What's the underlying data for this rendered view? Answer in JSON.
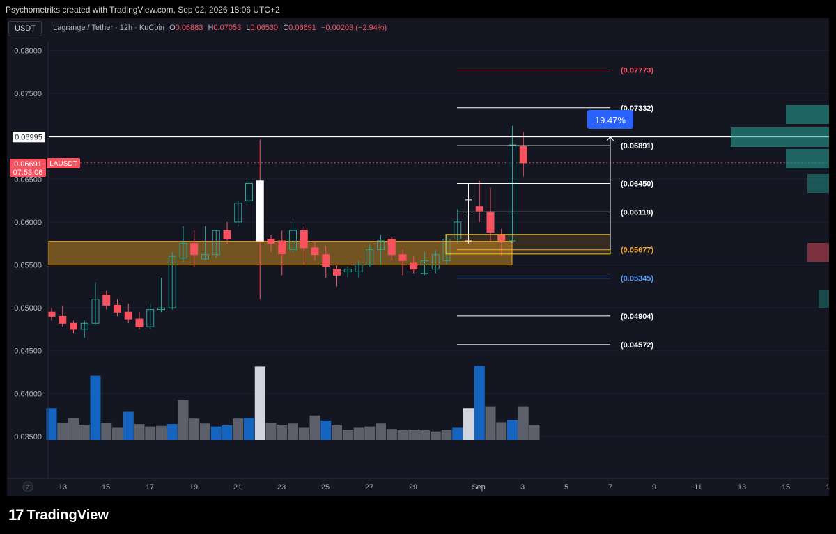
{
  "watermark": "Psychometriks created with TradingView.com, Sep 02, 2026 18:06 UTC+2",
  "symbol_box": "USDT",
  "header": {
    "title": "Lagrange / Tether · 12h · KuCoin",
    "o_label": "O",
    "o": "0.06883",
    "h_label": "H",
    "h": "0.07053",
    "l_label": "L",
    "l": "0.06530",
    "c_label": "C",
    "c": "0.06691",
    "change": "−0.00203 (−2.94%)"
  },
  "price_axis": {
    "ticks": [
      "0.08000",
      "0.07500",
      "0.06500",
      "0.06000",
      "0.05500",
      "0.05000",
      "0.04500",
      "0.04000",
      "0.03500"
    ],
    "horizontal_line_label": "0.06995",
    "last_price_label": "0.06691",
    "countdown": "07:53:06",
    "ticker_tag": "LAUSDT"
  },
  "time_axis": {
    "ticks": [
      "13",
      "15",
      "17",
      "19",
      "21",
      "23",
      "25",
      "27",
      "29",
      "Sep",
      "3",
      "5",
      "7",
      "9",
      "11",
      "13",
      "15",
      "1"
    ],
    "z_button": "Z"
  },
  "measure_label": "19.47%",
  "brand": "TradingView",
  "colors": {
    "up": "#26a69a",
    "down": "#f7525f",
    "zone": "#f5a623",
    "background": "#141722"
  },
  "chart_data": {
    "type": "candlestick",
    "timeframe": "12h",
    "ylim": [
      0.033,
      0.0825
    ],
    "candles": [
      {
        "o": 0.0495,
        "h": 0.05,
        "l": 0.0485,
        "c": 0.049
      },
      {
        "o": 0.049,
        "h": 0.0502,
        "l": 0.0478,
        "c": 0.0482
      },
      {
        "o": 0.0482,
        "h": 0.0485,
        "l": 0.047,
        "c": 0.0475
      },
      {
        "o": 0.0475,
        "h": 0.0485,
        "l": 0.0465,
        "c": 0.0482
      },
      {
        "o": 0.0482,
        "h": 0.053,
        "l": 0.048,
        "c": 0.051
      },
      {
        "o": 0.0515,
        "h": 0.052,
        "l": 0.0498,
        "c": 0.0503
      },
      {
        "o": 0.0503,
        "h": 0.051,
        "l": 0.049,
        "c": 0.0495
      },
      {
        "o": 0.0495,
        "h": 0.0505,
        "l": 0.0482,
        "c": 0.0487
      },
      {
        "o": 0.0487,
        "h": 0.0495,
        "l": 0.0475,
        "c": 0.0478
      },
      {
        "o": 0.0478,
        "h": 0.0505,
        "l": 0.0475,
        "c": 0.0498
      },
      {
        "o": 0.0498,
        "h": 0.0535,
        "l": 0.0495,
        "c": 0.05
      },
      {
        "o": 0.05,
        "h": 0.0565,
        "l": 0.0498,
        "c": 0.056
      },
      {
        "o": 0.0558,
        "h": 0.0595,
        "l": 0.0553,
        "c": 0.0575
      },
      {
        "o": 0.0575,
        "h": 0.059,
        "l": 0.0548,
        "c": 0.0562
      },
      {
        "o": 0.0557,
        "h": 0.0595,
        "l": 0.0555,
        "c": 0.0562
      },
      {
        "o": 0.0562,
        "h": 0.059,
        "l": 0.0558,
        "c": 0.059
      },
      {
        "o": 0.059,
        "h": 0.06,
        "l": 0.0575,
        "c": 0.058
      },
      {
        "o": 0.06,
        "h": 0.0625,
        "l": 0.0595,
        "c": 0.0622
      },
      {
        "o": 0.0625,
        "h": 0.065,
        "l": 0.062,
        "c": 0.0645
      },
      {
        "o": 0.0578,
        "h": 0.0696,
        "l": 0.051,
        "c": 0.0648
      },
      {
        "o": 0.058,
        "h": 0.0585,
        "l": 0.0565,
        "c": 0.0575
      },
      {
        "o": 0.0578,
        "h": 0.059,
        "l": 0.0538,
        "c": 0.0563
      },
      {
        "o": 0.0568,
        "h": 0.06,
        "l": 0.0565,
        "c": 0.059
      },
      {
        "o": 0.059,
        "h": 0.0595,
        "l": 0.055,
        "c": 0.057
      },
      {
        "o": 0.057,
        "h": 0.0578,
        "l": 0.0555,
        "c": 0.0562
      },
      {
        "o": 0.0562,
        "h": 0.0572,
        "l": 0.0535,
        "c": 0.0548
      },
      {
        "o": 0.0545,
        "h": 0.055,
        "l": 0.0525,
        "c": 0.0538
      },
      {
        "o": 0.0542,
        "h": 0.0548,
        "l": 0.0535,
        "c": 0.0545
      },
      {
        "o": 0.0542,
        "h": 0.0555,
        "l": 0.0535,
        "c": 0.055
      },
      {
        "o": 0.055,
        "h": 0.0575,
        "l": 0.0548,
        "c": 0.0568
      },
      {
        "o": 0.0568,
        "h": 0.0585,
        "l": 0.055,
        "c": 0.0578
      },
      {
        "o": 0.058,
        "h": 0.0582,
        "l": 0.0555,
        "c": 0.0562
      },
      {
        "o": 0.0562,
        "h": 0.0568,
        "l": 0.0538,
        "c": 0.0555
      },
      {
        "o": 0.0552,
        "h": 0.056,
        "l": 0.054,
        "c": 0.0545
      },
      {
        "o": 0.054,
        "h": 0.0565,
        "l": 0.0538,
        "c": 0.0555
      },
      {
        "o": 0.0545,
        "h": 0.0568,
        "l": 0.054,
        "c": 0.0562
      },
      {
        "o": 0.0555,
        "h": 0.0585,
        "l": 0.055,
        "c": 0.058
      },
      {
        "o": 0.058,
        "h": 0.0615,
        "l": 0.0575,
        "c": 0.06
      },
      {
        "o": 0.0578,
        "h": 0.0645,
        "l": 0.0575,
        "c": 0.0626
      },
      {
        "o": 0.0618,
        "h": 0.0648,
        "l": 0.06,
        "c": 0.0613
      },
      {
        "o": 0.0612,
        "h": 0.064,
        "l": 0.0578,
        "c": 0.0588
      },
      {
        "o": 0.0585,
        "h": 0.0592,
        "l": 0.056,
        "c": 0.0578
      },
      {
        "o": 0.0578,
        "h": 0.0712,
        "l": 0.0575,
        "c": 0.069
      },
      {
        "o": 0.0688,
        "h": 0.0705,
        "l": 0.0653,
        "c": 0.0669
      }
    ],
    "volume_colors": [
      "up",
      "down",
      "down",
      "down",
      "up",
      "down",
      "down",
      "up",
      "down",
      "down",
      "down",
      "up",
      "down",
      "down",
      "down",
      "up",
      "up",
      "down",
      "up",
      "white",
      "down",
      "down",
      "down",
      "down",
      "down",
      "up",
      "down",
      "down",
      "down",
      "down",
      "down",
      "down",
      "down",
      "down",
      "down",
      "down",
      "down",
      "up",
      "white",
      "up",
      "down",
      "down",
      "up",
      "down"
    ],
    "volume": [
      52,
      28,
      36,
      25,
      105,
      28,
      20,
      46,
      26,
      22,
      23,
      26,
      65,
      35,
      27,
      22,
      24,
      35,
      36,
      120,
      28,
      25,
      27,
      20,
      40,
      32,
      24,
      17,
      20,
      22,
      27,
      18,
      16,
      17,
      16,
      14,
      17,
      20,
      52,
      121,
      55,
      29,
      33,
      55,
      25
    ],
    "support_zone": {
      "top": 0.05775,
      "bottom": 0.055
    },
    "horizontal_line": 0.06995,
    "fib_levels": [
      {
        "value": 0.07773,
        "label": "(0.07773)",
        "color": "#f7525f"
      },
      {
        "value": 0.07332,
        "label": "(0.07332)",
        "color": "#ffffff"
      },
      {
        "value": 0.06891,
        "label": "(0.06891)",
        "color": "#ffffff"
      },
      {
        "value": 0.0645,
        "label": "(0.06450)",
        "color": "#ffffff"
      },
      {
        "value": 0.06118,
        "label": "(0.06118)",
        "color": "#ffffff"
      },
      {
        "value": 0.05677,
        "label": "(0.05677)",
        "color": "#f5a623"
      },
      {
        "value": 0.05345,
        "label": "(0.05345)",
        "color": "#5b9cf6"
      },
      {
        "value": 0.04904,
        "label": "(0.04904)",
        "color": "#ffffff"
      },
      {
        "value": 0.04572,
        "label": "(0.04572)",
        "color": "#ffffff"
      }
    ],
    "measure": {
      "from": 0.05677,
      "to": 0.06995,
      "percent": "19.47%"
    }
  }
}
